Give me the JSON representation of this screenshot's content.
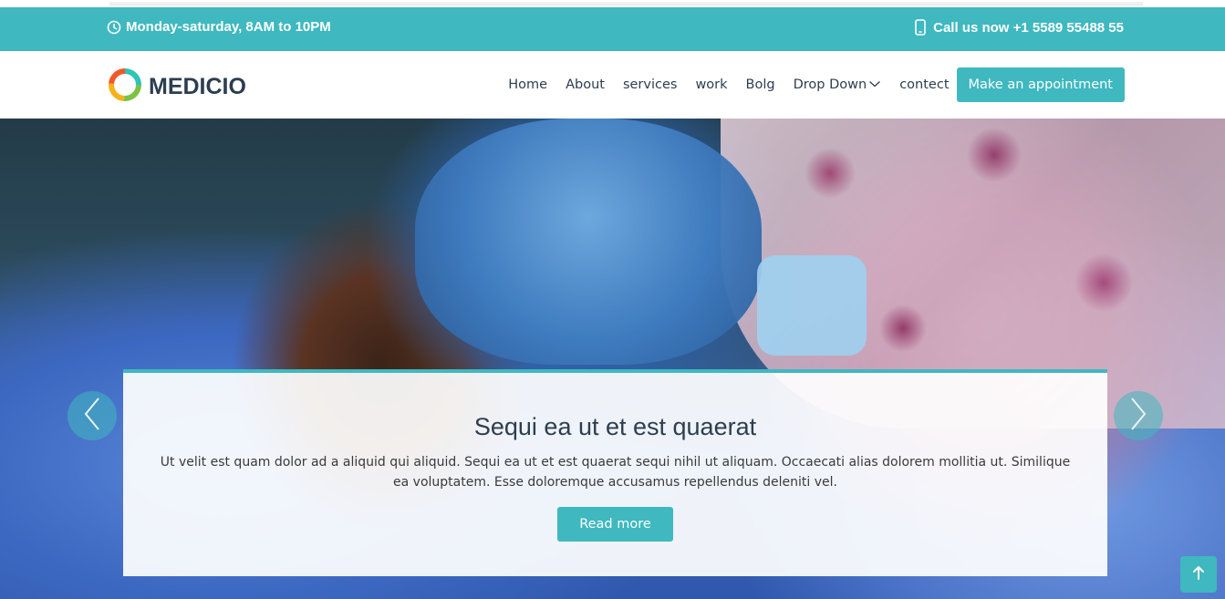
{
  "topbar": {
    "hours": "Monday-saturday, 8AM to 10PM",
    "phone": "Call us now +1 5589 55488 55"
  },
  "header": {
    "logo": "MEDICIO",
    "nav": [
      "Home",
      "About",
      "services",
      "work",
      "Bolg",
      "Drop Down",
      "contect"
    ],
    "cta": "Make an appointment"
  },
  "hero": {
    "title": "Sequi ea ut et est quaerat",
    "text": "Ut velit est quam dolor ad a aliquid qui aliquid. Sequi ea ut et est quaerat sequi nihil ut aliquam. Occaecati alias dolorem mollitia ut. Similique ea voluptatem. Esse doloremque accusamus repellendus deleniti vel.",
    "button": "Read more"
  },
  "icons": {
    "clock": "clock-icon",
    "phone": "phone-icon",
    "chevron": "chevron-down-icon",
    "prev": "chevron-left-icon",
    "next": "chevron-right-icon",
    "top": "arrow-up-icon"
  },
  "colors": {
    "accent": "#3fb8c0",
    "text": "#2c3e50"
  }
}
